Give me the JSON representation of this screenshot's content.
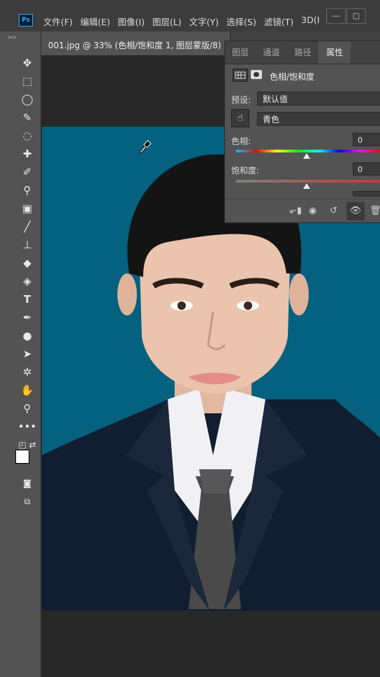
{
  "app": {
    "logo": "Ps"
  },
  "menu": [
    "文件(F)",
    "编辑(E)",
    "图像(I)",
    "图层(L)",
    "文字(Y)",
    "选择(S)",
    "滤镜(T)",
    "3D(I"
  ],
  "window_controls": {
    "minimize": "—",
    "restore": "▢"
  },
  "toolbar": {
    "grip": ">>",
    "tools": [
      "move-tool",
      "marquee-tool",
      "lasso-tool",
      "quick-select-tool",
      "spot-heal-tool",
      "healing-brush-tool",
      "eyedropper-tool",
      "gradient-tool",
      "brush-tool",
      "stamp-tool",
      "eraser-tool",
      "paint-bucket-tool",
      "type-tool",
      "pen-tool",
      "dodge-tool",
      "path-select-tool",
      "custom-shape-tool",
      "hand-tool",
      "zoom-tool",
      "more-tools"
    ]
  },
  "document_tab": {
    "title": "001.jpg @ 33% (色相/饱和度 1, 图层蒙版/8) *"
  },
  "properties_panel": {
    "tabs": [
      "图层",
      "通道",
      "路径",
      "属性"
    ],
    "active_tab": "属性",
    "adjustment_title": "色相/饱和度",
    "preset_label": "预设:",
    "preset_value": "默认值",
    "channel_value": "青色",
    "hue_label": "色相:",
    "hue_value": "0",
    "saturation_label": "饱和度:",
    "saturation_value": "0"
  },
  "colors": {
    "canvas_bg": "#04617f",
    "panel_bg": "#535353",
    "menubar_bg": "#3c3c3c",
    "accent": "#31a8ff"
  }
}
